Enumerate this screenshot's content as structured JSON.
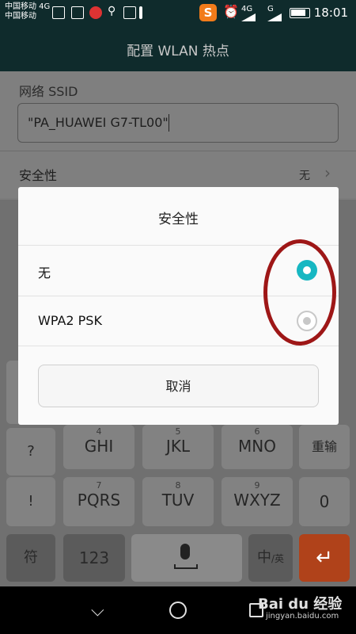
{
  "status_bar": {
    "carrier1": "中国移动 4G",
    "carrier2": "中国移动",
    "net1": "4G",
    "net2": "G",
    "time": "18:01"
  },
  "title": "配置 WLAN 热点",
  "form": {
    "ssid_label": "网络 SSID",
    "ssid_value": "\"PA_HUAWEI G7-TL00\"",
    "security_label": "安全性",
    "security_value": "无"
  },
  "dialog": {
    "title": "安全性",
    "options": [
      {
        "label": "无",
        "selected": true
      },
      {
        "label": "WPA2 PSK",
        "selected": false
      }
    ],
    "cancel_label": "取消"
  },
  "keyboard": {
    "row1": [
      {
        "letters": "GHI",
        "digit": "4"
      },
      {
        "letters": "JKL",
        "digit": "5"
      },
      {
        "letters": "MNO",
        "digit": "6"
      }
    ],
    "row2": [
      {
        "letters": "PQRS",
        "digit": "7"
      },
      {
        "letters": "TUV",
        "digit": "8"
      },
      {
        "letters": "WXYZ",
        "digit": "9"
      }
    ],
    "left_keys": [
      "?",
      "!"
    ],
    "redo_label": "重输",
    "zero_label": "0",
    "sym_label": "符",
    "num_label": "123",
    "lang_label": "中",
    "lang_sub": "/英"
  },
  "watermark": {
    "main": "Bai du 经验",
    "sub": "jingyan.baidu.com"
  }
}
